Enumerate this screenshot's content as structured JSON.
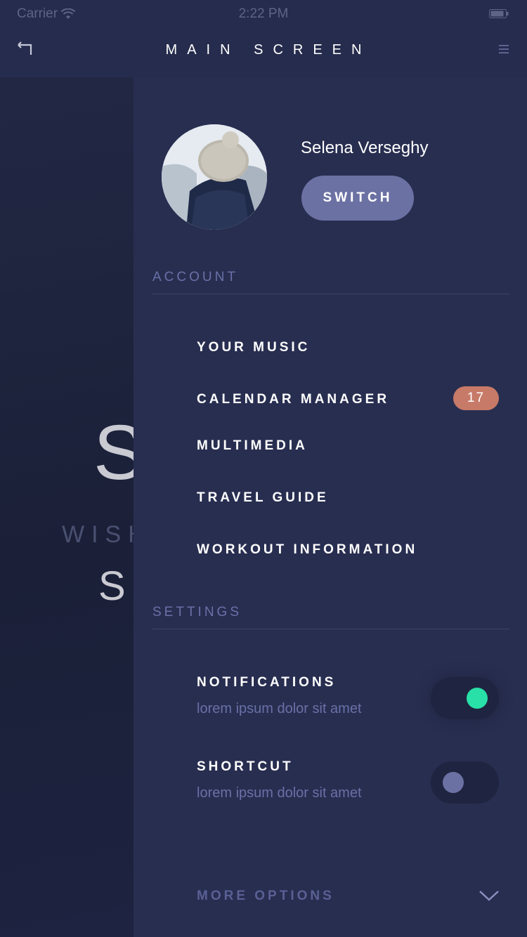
{
  "status_bar": {
    "carrier": "Carrier",
    "time": "2:22 PM"
  },
  "nav": {
    "title": "MAIN SCREEN",
    "back_icon": "back-arrow-icon",
    "menu_icon": "hamburger-menu-icon"
  },
  "background": {
    "big_letter": "S",
    "sub_text": "WISH",
    "small_letter": "S"
  },
  "drawer": {
    "user_name": "Selena Verseghy",
    "switch_label": "SWITCH",
    "account_header": "ACCOUNT",
    "account_items": [
      {
        "label": "YOUR MUSIC"
      },
      {
        "label": "CALENDAR MANAGER",
        "badge": "17"
      },
      {
        "label": "MULTIMEDIA"
      },
      {
        "label": "TRAVEL GUIDE"
      },
      {
        "label": "WORKOUT INFORMATION"
      }
    ],
    "settings_header": "SETTINGS",
    "settings": [
      {
        "label": "NOTIFICATIONS",
        "description": "lorem ipsum dolor sit amet",
        "enabled": true
      },
      {
        "label": "SHORTCUT",
        "description": "lorem ipsum dolor sit amet",
        "enabled": false
      }
    ],
    "more_options": "MORE OPTIONS"
  },
  "colors": {
    "background": "#1f2440",
    "drawer": "#282e50",
    "accent": "#6c71a4",
    "badge": "#c77a68",
    "toggle_on": "#28e0a8"
  }
}
